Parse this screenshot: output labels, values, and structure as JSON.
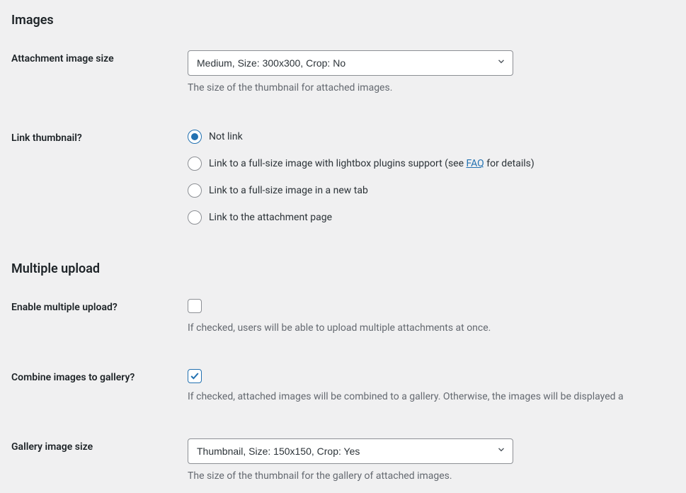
{
  "sections": {
    "images_heading": "Images",
    "multiple_upload_heading": "Multiple upload"
  },
  "attachment_size": {
    "label": "Attachment image size",
    "selected": "Medium, Size: 300x300, Crop: No",
    "help": "The size of the thumbnail for attached images."
  },
  "link_thumbnail": {
    "label": "Link thumbnail?",
    "options": {
      "not_link": "Not link",
      "lightbox_prefix": "Link to a full-size image with lightbox plugins support (see ",
      "lightbox_link": "FAQ",
      "lightbox_suffix": " for details)",
      "new_tab": "Link to a full-size image in a new tab",
      "attachment_page": "Link to the attachment page"
    }
  },
  "enable_multiple": {
    "label": "Enable multiple upload?",
    "help": "If checked, users will be able to upload multiple attachments at once."
  },
  "combine_gallery": {
    "label": "Combine images to gallery?",
    "help": "If checked, attached images will be combined to a gallery. Otherwise, the images will be displayed a"
  },
  "gallery_size": {
    "label": "Gallery image size",
    "selected": "Thumbnail, Size: 150x150, Crop: Yes",
    "help": "The size of the thumbnail for the gallery of attached images."
  }
}
